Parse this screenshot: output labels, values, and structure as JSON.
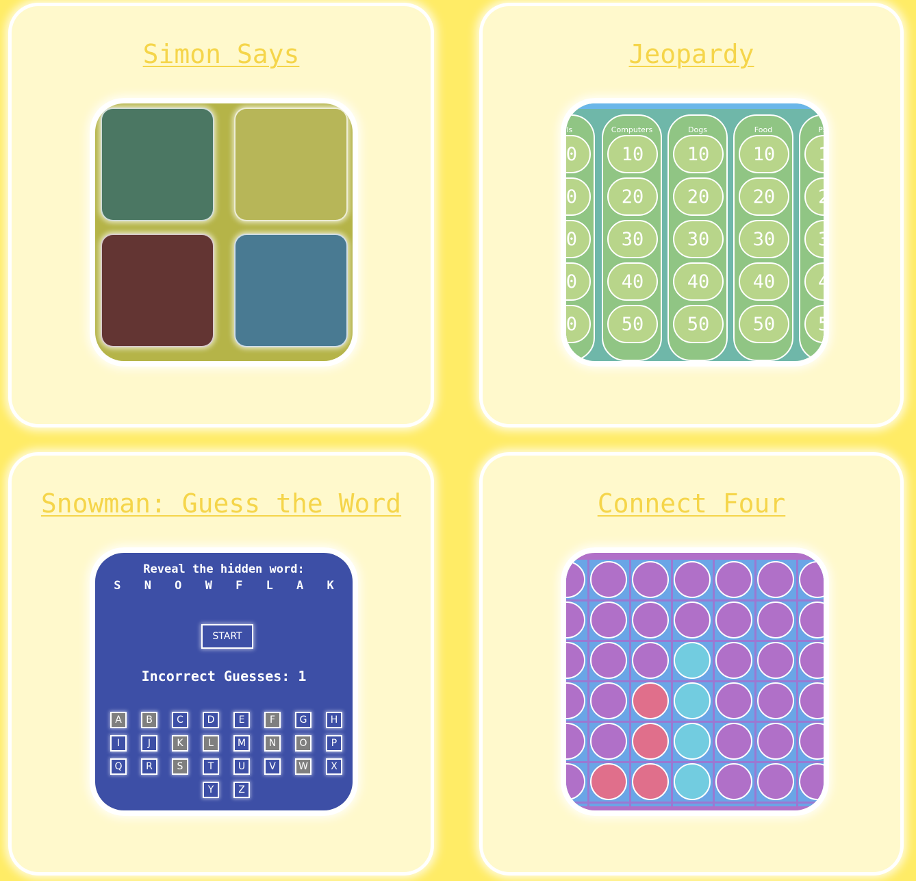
{
  "colors": {
    "page_background": "#ffec66",
    "card_background": "#fff9cc",
    "title_color": "#f5d54a"
  },
  "cards": {
    "simon": {
      "title": "Simon Says",
      "pads": [
        {
          "name": "green",
          "color": "#4b7763"
        },
        {
          "name": "yellow",
          "color": "#b7b658"
        },
        {
          "name": "red",
          "color": "#633533"
        },
        {
          "name": "blue",
          "color": "#497a92"
        }
      ]
    },
    "jeopardy": {
      "title": "Jeopardy",
      "categories": [
        "nals",
        "Computers",
        "Dogs",
        "Food",
        "Psych"
      ],
      "values": [
        "10",
        "20",
        "30",
        "40",
        "50"
      ],
      "left_partial_values": [
        "0",
        "0",
        "0",
        "0",
        "0"
      ],
      "right_partial_values": [
        "1",
        "2",
        "3",
        "4",
        "5"
      ]
    },
    "snowman": {
      "title": "Snowman: Guess the Word",
      "reveal_label": "Reveal the hidden word:",
      "hidden_word": "S N O W F L A K",
      "start_label": "START",
      "incorrect_label": "Incorrect Guesses: 1",
      "keys": [
        {
          "letter": "A",
          "used": true
        },
        {
          "letter": "B",
          "used": true
        },
        {
          "letter": "C",
          "used": false
        },
        {
          "letter": "D",
          "used": false
        },
        {
          "letter": "E",
          "used": false
        },
        {
          "letter": "F",
          "used": true
        },
        {
          "letter": "G",
          "used": false
        },
        {
          "letter": "H",
          "used": false
        },
        {
          "letter": "I",
          "used": false
        },
        {
          "letter": "J",
          "used": false
        },
        {
          "letter": "K",
          "used": true
        },
        {
          "letter": "L",
          "used": true
        },
        {
          "letter": "M",
          "used": false
        },
        {
          "letter": "N",
          "used": true
        },
        {
          "letter": "O",
          "used": true
        },
        {
          "letter": "P",
          "used": false
        },
        {
          "letter": "Q",
          "used": false
        },
        {
          "letter": "R",
          "used": false
        },
        {
          "letter": "S",
          "used": true
        },
        {
          "letter": "T",
          "used": false
        },
        {
          "letter": "U",
          "used": false
        },
        {
          "letter": "V",
          "used": false
        },
        {
          "letter": "W",
          "used": true
        },
        {
          "letter": "X",
          "used": false
        },
        {
          "letter": "Y",
          "used": false
        },
        {
          "letter": "Z",
          "used": false
        }
      ]
    },
    "connect_four": {
      "title": "Connect Four",
      "colors": {
        "empty": "#b070c8",
        "red": "#e06f8b",
        "cyan": "#72cce0"
      },
      "board": [
        [
          "empty",
          "empty",
          "empty",
          "empty",
          "empty",
          "empty",
          "empty"
        ],
        [
          "empty",
          "empty",
          "empty",
          "empty",
          "empty",
          "empty",
          "empty"
        ],
        [
          "empty",
          "empty",
          "empty",
          "cyan",
          "empty",
          "empty",
          "empty"
        ],
        [
          "empty",
          "empty",
          "red",
          "cyan",
          "empty",
          "empty",
          "empty"
        ],
        [
          "empty",
          "empty",
          "red",
          "cyan",
          "empty",
          "empty",
          "empty"
        ],
        [
          "empty",
          "red",
          "red",
          "cyan",
          "empty",
          "empty",
          "empty"
        ]
      ]
    }
  }
}
